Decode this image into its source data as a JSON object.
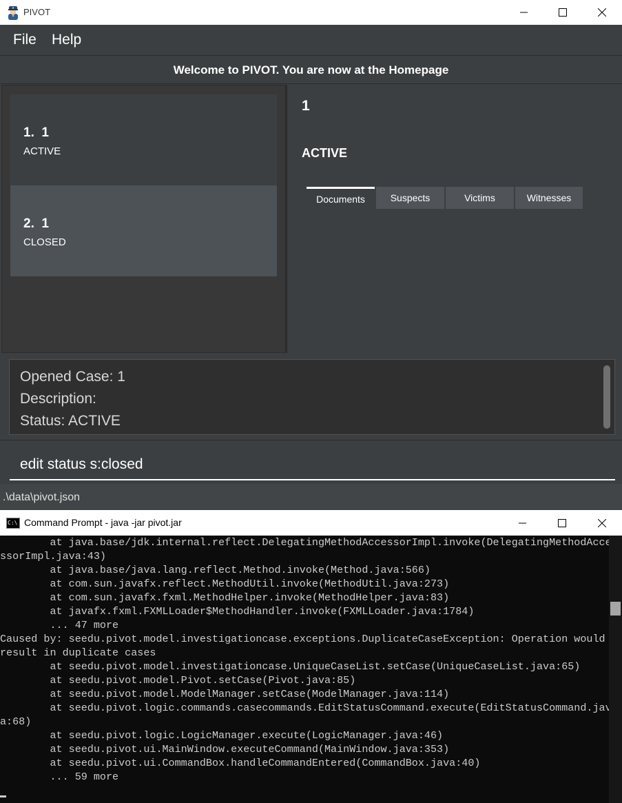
{
  "pivot": {
    "title": "PIVOT",
    "menu": [
      "File",
      "Help"
    ],
    "header": "Welcome to PIVOT. You are now at the Homepage",
    "cases": [
      {
        "index": "1.",
        "title": "1",
        "status": "ACTIVE"
      },
      {
        "index": "2.",
        "title": "1",
        "status": "CLOSED"
      }
    ],
    "detail": {
      "title": "1",
      "status": "ACTIVE",
      "tabs": [
        "Documents",
        "Suspects",
        "Victims",
        "Witnesses"
      ],
      "selected_tab": "Documents"
    },
    "result": [
      "Opened Case: 1",
      "Description:",
      "Status: ACTIVE"
    ],
    "command_value": "edit status s:closed",
    "status_path": ".\\data\\pivot.json"
  },
  "cmd": {
    "title": "Command Prompt - java  -jar pivot.jar",
    "icon_label": "C:\\",
    "lines": [
      "        at java.base/jdk.internal.reflect.DelegatingMethodAccessorImpl.invoke(DelegatingMethodAcce",
      "ssorImpl.java:43)",
      "        at java.base/java.lang.reflect.Method.invoke(Method.java:566)",
      "        at com.sun.javafx.reflect.MethodUtil.invoke(MethodUtil.java:273)",
      "        at com.sun.javafx.fxml.MethodHelper.invoke(MethodHelper.java:83)",
      "        at javafx.fxml.FXMLLoader$MethodHandler.invoke(FXMLLoader.java:1784)",
      "        ... 47 more",
      "Caused by: seedu.pivot.model.investigationcase.exceptions.DuplicateCaseException: Operation would",
      "result in duplicate cases",
      "        at seedu.pivot.model.investigationcase.UniqueCaseList.setCase(UniqueCaseList.java:65)",
      "        at seedu.pivot.model.Pivot.setCase(Pivot.java:85)",
      "        at seedu.pivot.model.ModelManager.setCase(ModelManager.java:114)",
      "        at seedu.pivot.logic.commands.casecommands.EditStatusCommand.execute(EditStatusCommand.jav",
      "a:68)",
      "        at seedu.pivot.logic.LogicManager.execute(LogicManager.java:46)",
      "        at seedu.pivot.ui.MainWindow.executeCommand(MainWindow.java:353)",
      "        at seedu.pivot.ui.CommandBox.handleCommandEntered(CommandBox.java:40)",
      "        ... 59 more"
    ]
  },
  "colors": {
    "pivot_bg": "#3c3f41",
    "card_active": "#3c3f41",
    "card_closed": "#4c5256",
    "tab_bg": "#505459",
    "console_bg": "#0c0c0c",
    "console_text": "#cccccc"
  },
  "icons": {
    "app": "police-officer-icon",
    "cmd": "command-prompt-icon"
  }
}
